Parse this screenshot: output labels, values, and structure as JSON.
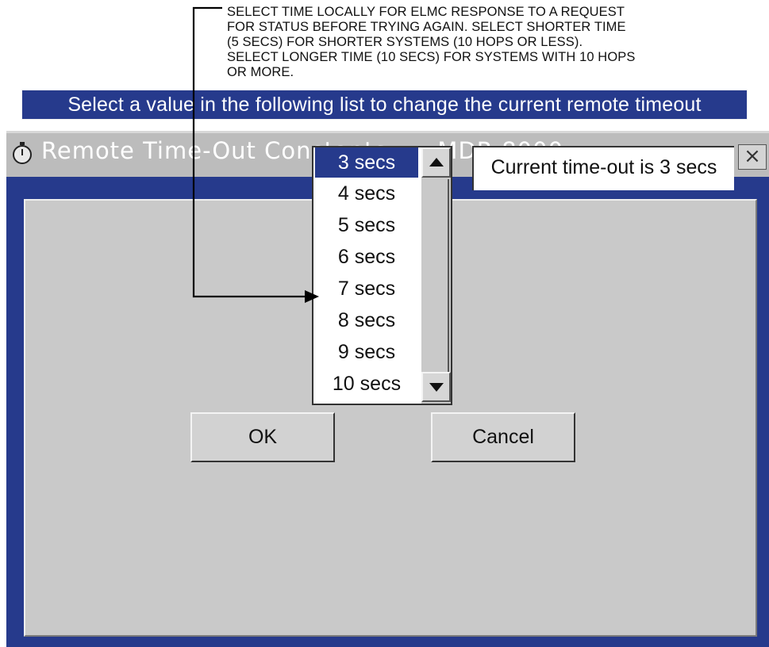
{
  "callout": {
    "text": "SELECT TIME LOCALLY FOR ELMC RESPONSE TO A REQUEST\nFOR STATUS BEFORE TRYING AGAIN. SELECT SHORTER TIME\n(5 SECS) FOR SHORTER SYSTEMS (10 HOPS OR LESS).\nSELECT LONGER TIME (10 SECS) FOR SYSTEMS WITH 10 HOPS\nOR MORE."
  },
  "window": {
    "title": "Remote Time-Out Constants  --  MDR-8000",
    "title_icon": "stopwatch-icon",
    "close_label": "×",
    "colors": {
      "titlebar": "#bcbcbc",
      "frame": "#263a8c",
      "client": "#c9c9c9",
      "selection": "#263a8c"
    }
  },
  "dialog": {
    "instruction": "Select a value in the following list to change the current remote timeout",
    "timeout_options": [
      "3 secs",
      "4 secs",
      "5 secs",
      "6 secs",
      "7 secs",
      "8 secs",
      "9 secs",
      "10 secs"
    ],
    "selected_option": "3 secs",
    "current_status": "Current time-out is 3 secs",
    "ok_label": "OK",
    "cancel_label": "Cancel",
    "scroll_up_icon": "triangle-up-icon",
    "scroll_down_icon": "triangle-down-icon"
  }
}
